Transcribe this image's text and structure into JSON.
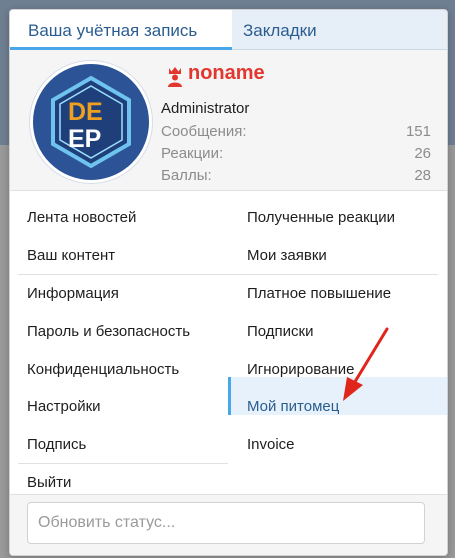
{
  "tabs": [
    {
      "label": "Ваша учётная запись",
      "active": true
    },
    {
      "label": "Закладки",
      "active": false
    }
  ],
  "profile": {
    "avatar_text_top": "DE",
    "avatar_text_bottom": "EP",
    "username": "noname",
    "role": "Administrator",
    "stats": [
      {
        "label": "Сообщения:",
        "value": "151"
      },
      {
        "label": "Реакции:",
        "value": "26"
      },
      {
        "label": "Баллы:",
        "value": "28"
      }
    ]
  },
  "menu": {
    "left": [
      "Лента новостей",
      "Ваш контент",
      "Информация",
      "Пароль и безопасность",
      "Конфиденциальность",
      "Настройки",
      "Подпись",
      "Выйти"
    ],
    "right": [
      "Полученные реакции",
      "Мои заявки",
      "Платное повышение",
      "Подписки",
      "Игнорирование",
      "Мой питомец",
      "Invoice"
    ]
  },
  "status": {
    "placeholder": "Обновить статус..."
  },
  "colors": {
    "accent": "#47a7eb",
    "username": "#e2372f",
    "arrow": "#e0261c",
    "tab_text": "#2b5d8f"
  }
}
